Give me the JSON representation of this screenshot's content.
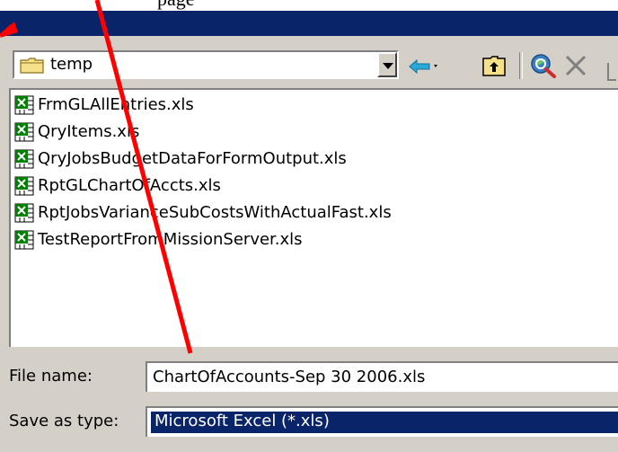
{
  "caption": {
    "text": "page"
  },
  "look_in": {
    "value": "temp"
  },
  "files": [
    {
      "name": "FrmGLAllEntries.xls"
    },
    {
      "name": "QryItems.xls"
    },
    {
      "name": "QryJobsBudgetDataForFormOutput.xls"
    },
    {
      "name": "RptGLChartOfAccts.xls"
    },
    {
      "name": "RptJobsVarianceSubCostsWithActualFast.xls"
    },
    {
      "name": "TestReportFromMissionServer.xls"
    }
  ],
  "file_name": {
    "label": "File name:",
    "value": "ChartOfAccounts-Sep 30 2006.xls"
  },
  "save_as_type": {
    "label": "Save as type:",
    "value": "Microsoft Excel (*.xls)"
  },
  "colors": {
    "titlebar": "#0a246a",
    "face": "#d4d0c8",
    "annotation": "#ff0000",
    "excel_green": "#008000"
  },
  "icons": [
    "folder-icon",
    "back-arrow-icon",
    "up-folder-icon",
    "search-web-icon",
    "delete-icon",
    "excel-file-icon"
  ]
}
